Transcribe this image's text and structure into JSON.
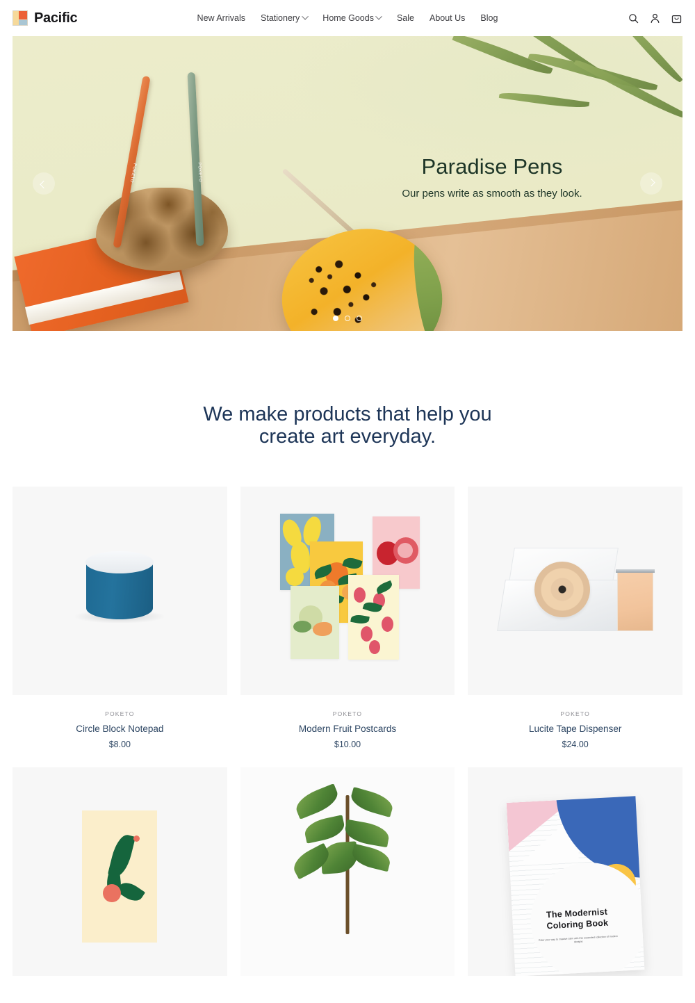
{
  "brand": {
    "name": "Pacific",
    "logo_icon": "pacific-logo-blocks"
  },
  "nav": {
    "items": [
      {
        "label": "New Arrivals",
        "has_dropdown": false
      },
      {
        "label": "Stationery",
        "has_dropdown": true
      },
      {
        "label": "Home Goods",
        "has_dropdown": true
      },
      {
        "label": "Sale",
        "has_dropdown": false
      },
      {
        "label": "About Us",
        "has_dropdown": false
      },
      {
        "label": "Blog",
        "has_dropdown": false
      }
    ]
  },
  "header_icons": [
    {
      "name": "search-icon"
    },
    {
      "name": "account-icon"
    },
    {
      "name": "cart-icon"
    }
  ],
  "hero": {
    "title": "Paradise Pens",
    "subtitle": "Our pens write as smooth as they look.",
    "prev_label": "Previous slide",
    "next_label": "Next slide",
    "slide_count": 3,
    "active_slide": 1,
    "pen_label_1": "POKETO",
    "pen_label_2": "POKETO",
    "background_color": "#eaebc8",
    "title_color": "#1d3527"
  },
  "section": {
    "heading_line1": "We make products that help you",
    "heading_line2": "create art everyday.",
    "heading_color": "#1d3557"
  },
  "products": [
    {
      "vendor": "POKETO",
      "title": "Circle Block Notepad",
      "price": "$8.00",
      "art": "notepad"
    },
    {
      "vendor": "POKETO",
      "title": "Modern Fruit Postcards",
      "price": "$10.00",
      "art": "postcards"
    },
    {
      "vendor": "POKETO",
      "title": "Lucite Tape Dispenser",
      "price": "$24.00",
      "art": "tape"
    },
    {
      "vendor": "",
      "title": "",
      "price": "",
      "art": "art-print"
    },
    {
      "vendor": "",
      "title": "",
      "price": "",
      "art": "plant"
    },
    {
      "vendor": "",
      "title": "",
      "price": "",
      "art": "coloring-book"
    }
  ],
  "coloring_book": {
    "title_line1": "The Modernist",
    "title_line2": "Coloring Book",
    "subtitle": "Color your way to creative calm with this expanded collection of modern designs"
  },
  "colors": {
    "page_background": "#ffffff",
    "card_background": "#f7f7f7",
    "text_navy": "#2d4663",
    "text_muted": "#8d8d93",
    "logo_orange": "#ec6136",
    "logo_blue": "#a9c6d4",
    "logo_cream": "#f6d99a"
  }
}
